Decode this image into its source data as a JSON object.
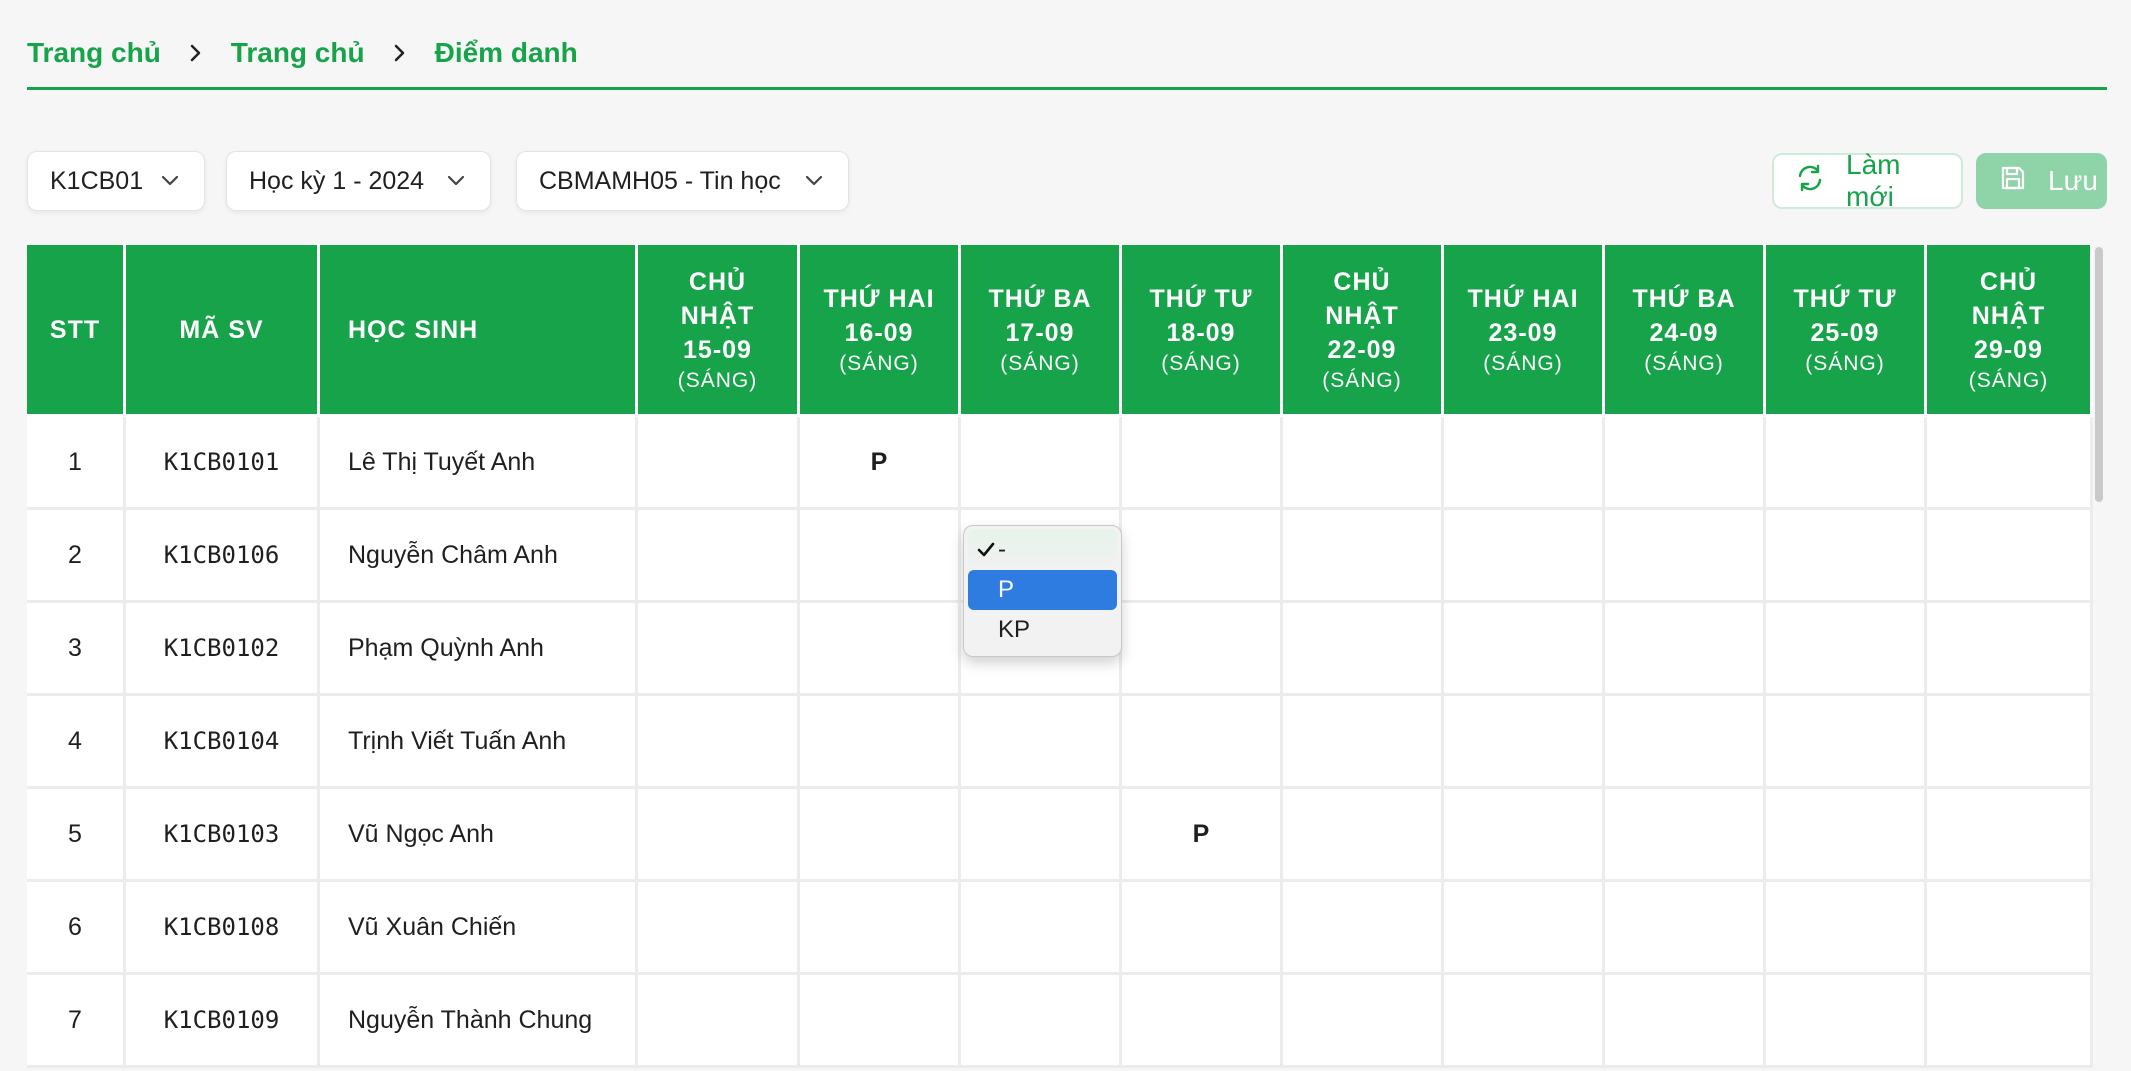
{
  "breadcrumb": [
    "Trang chủ",
    "Trang chủ",
    "Điểm danh"
  ],
  "filters": {
    "class": "K1CB01",
    "semester": "Học kỳ 1 - 2024",
    "subject": "CBMAMH05 - Tin học"
  },
  "actions": {
    "refresh": "Làm mới",
    "save": "Lưu"
  },
  "columns": {
    "stt": "STT",
    "code": "MÃ SV",
    "name": "HỌC SINH",
    "days": [
      {
        "line1": "CHỦ",
        "line2": "NHẬT",
        "date": "15-09",
        "session": "(SÁNG)"
      },
      {
        "line1": "THỨ HAI",
        "line2": "",
        "date": "16-09",
        "session": "(SÁNG)"
      },
      {
        "line1": "THỨ BA",
        "line2": "",
        "date": "17-09",
        "session": "(SÁNG)"
      },
      {
        "line1": "THỨ TƯ",
        "line2": "",
        "date": "18-09",
        "session": "(SÁNG)"
      },
      {
        "line1": "CHỦ",
        "line2": "NHẬT",
        "date": "22-09",
        "session": "(SÁNG)"
      },
      {
        "line1": "THỨ HAI",
        "line2": "",
        "date": "23-09",
        "session": "(SÁNG)"
      },
      {
        "line1": "THỨ BA",
        "line2": "",
        "date": "24-09",
        "session": "(SÁNG)"
      },
      {
        "line1": "THỨ TƯ",
        "line2": "",
        "date": "25-09",
        "session": "(SÁNG)"
      },
      {
        "line1": "CHỦ",
        "line2": "NHẬT",
        "date": "29-09",
        "session": "(SÁNG)"
      }
    ]
  },
  "rows": [
    {
      "stt": "1",
      "code": "K1CB0101",
      "name": "Lê Thị Tuyết Anh",
      "marks": [
        "",
        "P",
        "",
        "",
        "",
        "",
        "",
        "",
        ""
      ]
    },
    {
      "stt": "2",
      "code": "K1CB0106",
      "name": "Nguyễn Châm Anh",
      "marks": [
        "",
        "",
        "",
        "",
        "",
        "",
        "",
        "",
        ""
      ]
    },
    {
      "stt": "3",
      "code": "K1CB0102",
      "name": "Phạm Quỳnh Anh",
      "marks": [
        "",
        "",
        "",
        "",
        "",
        "",
        "",
        "",
        ""
      ]
    },
    {
      "stt": "4",
      "code": "K1CB0104",
      "name": "Trịnh Viết Tuấn Anh",
      "marks": [
        "",
        "",
        "",
        "",
        "",
        "",
        "",
        "",
        ""
      ]
    },
    {
      "stt": "5",
      "code": "K1CB0103",
      "name": "Vũ Ngọc Anh",
      "marks": [
        "",
        "",
        "",
        "P",
        "",
        "",
        "",
        "",
        ""
      ]
    },
    {
      "stt": "6",
      "code": "K1CB0108",
      "name": "Vũ Xuân Chiến",
      "marks": [
        "",
        "",
        "",
        "",
        "",
        "",
        "",
        "",
        ""
      ]
    },
    {
      "stt": "7",
      "code": "K1CB0109",
      "name": "Nguyễn Thành Chung",
      "marks": [
        "",
        "",
        "",
        "",
        "",
        "",
        "",
        "",
        ""
      ]
    }
  ],
  "dropdown": {
    "options": [
      "-",
      "P",
      "KP"
    ],
    "checked": "-",
    "highlighted": "P"
  },
  "colors": {
    "primary": "#17a34a",
    "highlight": "#2f7ce0"
  },
  "icons": {
    "refresh": "refresh-icon",
    "save": "save-icon",
    "chevron": "chevron-down-icon",
    "separator": "chevron-right-icon",
    "check": "check-icon"
  }
}
